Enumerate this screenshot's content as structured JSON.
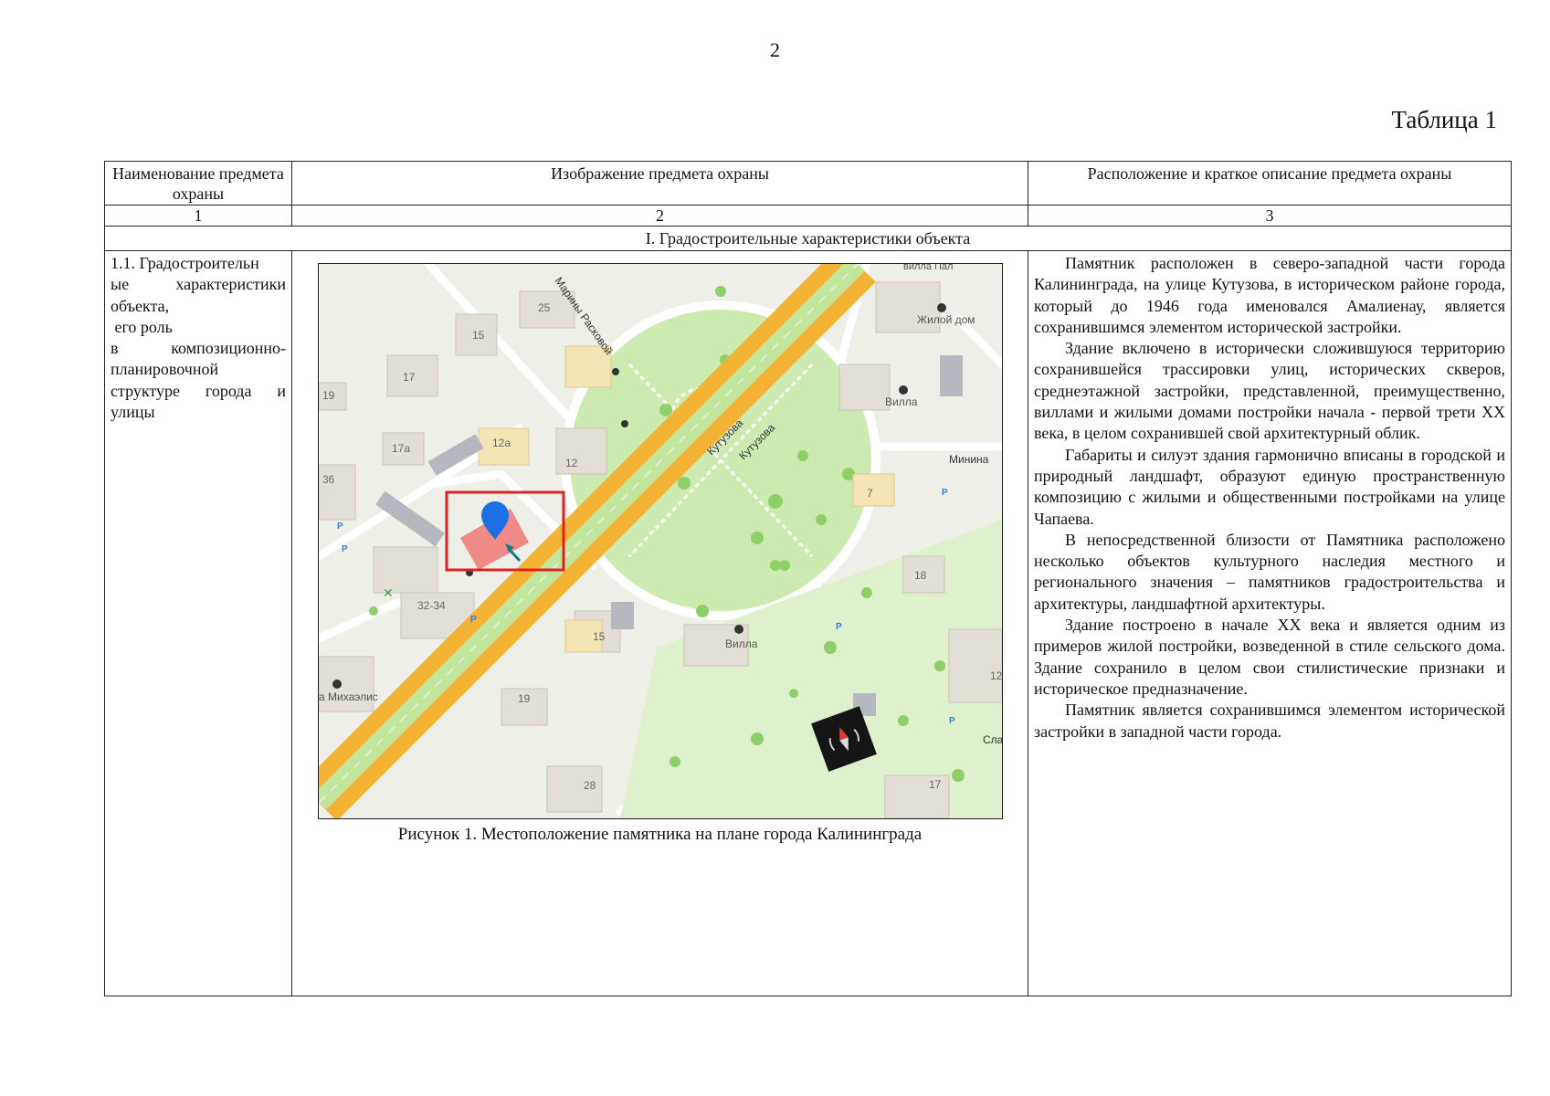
{
  "page": {
    "number": "2",
    "table_label": "Таблица 1"
  },
  "table": {
    "headers": [
      "Наименование предмета охраны",
      "Изображение предмета охраны",
      "Расположение и краткое описание предмета охраны"
    ],
    "column_numbers": [
      "1",
      "2",
      "3"
    ],
    "section_title": "I. Градостроительные характеристики объекта",
    "row": {
      "name_lines": [
        "1.1. Градостроительн",
        "ые характеристики",
        "объекта,",
        " его роль",
        "в композиционно-",
        "планировочной",
        "структуре города и",
        "улицы"
      ],
      "figure_caption": "Рисунок 1. Местоположение памятника на плане города Калининграда",
      "description": [
        "Памятник расположен в северо-западной части города Калининграда, на улице Кутузова, в историческом районе города, который до 1946 года именовался  Амалиенау, является сохранившимся элементом исторической застройки.",
        "Здание включено в исторически сложившуюся территорию сохранившейся трассировки улиц, исторических скверов, среднеэтажной застройки, представленной, преимущественно, виллами и жилыми домами постройки начала - первой трети XX века, в целом сохранившей свой архитектурный облик.",
        "Габариты и силуэт здания гармонично вписаны в городской и природный ландшафт, образуют единую пространственную композицию с жилыми и общественными постройками на улице Чапаева.",
        "В непосредственной близости от Памятника расположено несколько объектов культурного наследия местного и регионального значения – памятников градостроительства и архитектуры, ландшафтной архитектуры.",
        "Здание построено в начале XX века и является одним из примеров жилой постройки, возведенной в стиле сельского дома. Здание сохранило в целом свои стилистические признаки  и историческое предназначение.",
        "Памятник является сохранившимся элементом исторической застройки в западной части города."
      ]
    }
  },
  "map": {
    "street_labels": [
      "Кутузова",
      "Кутузова",
      "Марины Расковой",
      "Минина",
      "Сла"
    ],
    "house_numbers": [
      "25",
      "15",
      "17",
      "19",
      "17а",
      "12а",
      "12",
      "36",
      "32-34",
      "15",
      "19",
      "28",
      "7",
      "18",
      "12",
      "17"
    ],
    "poi_labels": [
      "Жилой дом",
      "Вилла",
      "Вилла",
      "а Михаэлис"
    ],
    "top_cut_label": "вилла Пал",
    "colors": {
      "background": "#eef0e7",
      "park": "#cdeab0",
      "road": "#f5b335",
      "road_median": "#c3e59b",
      "highlight": "#e02020",
      "building_highlight": "#f08a86",
      "marker": "#1e6fe3",
      "arrow": "#0e7f8a"
    },
    "icons": [
      "location-marker-icon",
      "direction-arrow-icon",
      "compass-icon",
      "house-pin-icon",
      "parking-icon"
    ]
  }
}
